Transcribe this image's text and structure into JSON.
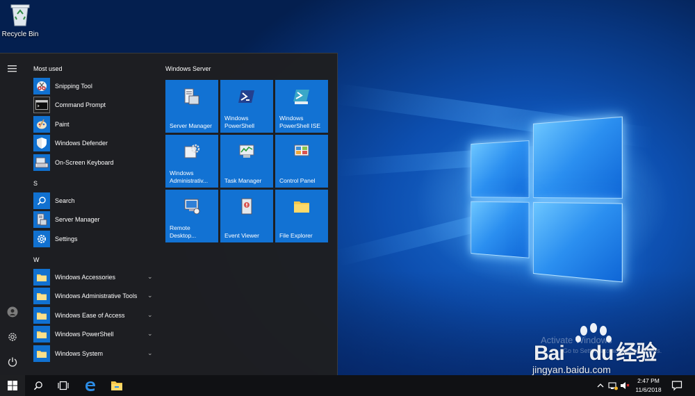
{
  "desktop": {
    "recycle_bin_label": "Recycle Bin",
    "watermark": {
      "activate": "Activate Windows",
      "activate_sub": "Go to Settings to activate Windows.",
      "brand_cn": "经验",
      "brand_text": "Bai",
      "brand_du": "du",
      "url": "jingyan.baidu.com"
    }
  },
  "start_menu": {
    "rail": {
      "hamburger_icon": "hamburger-icon",
      "user_icon": "user-icon",
      "settings_icon": "gear-icon",
      "power_icon": "power-icon"
    },
    "sections": [
      {
        "header": "Most used"
      },
      {
        "header": "S"
      },
      {
        "header": "W"
      }
    ],
    "apps": [
      {
        "label": "Snipping Tool",
        "icon": "scissors-icon"
      },
      {
        "label": "Command Prompt",
        "icon": "terminal-icon"
      },
      {
        "label": "Paint",
        "icon": "palette-icon"
      },
      {
        "label": "Windows Defender",
        "icon": "shield-icon"
      },
      {
        "label": "On-Screen Keyboard",
        "icon": "keyboard-icon"
      },
      {
        "label": "Search",
        "icon": "search-icon"
      },
      {
        "label": "Server Manager",
        "icon": "server-icon"
      },
      {
        "label": "Settings",
        "icon": "gear-icon"
      },
      {
        "label": "Windows Accessories",
        "icon": "folder-icon"
      },
      {
        "label": "Windows Administrative Tools",
        "icon": "folder-icon"
      },
      {
        "label": "Windows Ease of Access",
        "icon": "folder-icon"
      },
      {
        "label": "Windows PowerShell",
        "icon": "folder-icon"
      },
      {
        "label": "Windows System",
        "icon": "folder-icon"
      }
    ],
    "tiles_group": "Windows Server",
    "tiles": [
      {
        "label": "Server Manager",
        "icon": "server-icon"
      },
      {
        "label": "Windows PowerShell",
        "icon": "powershell-icon"
      },
      {
        "label": "Windows PowerShell ISE",
        "icon": "powershell-ise-icon"
      },
      {
        "label": "Windows Administrativ...",
        "icon": "admin-tools-icon"
      },
      {
        "label": "Task Manager",
        "icon": "task-manager-icon"
      },
      {
        "label": "Control Panel",
        "icon": "control-panel-icon"
      },
      {
        "label": "Remote Desktop...",
        "icon": "remote-desktop-icon"
      },
      {
        "label": "Event Viewer",
        "icon": "event-viewer-icon"
      },
      {
        "label": "File Explorer",
        "icon": "folder-icon"
      }
    ]
  },
  "taskbar": {
    "buttons": [
      "windows-logo-icon",
      "search-icon",
      "task-view-icon",
      "edge-icon",
      "file-explorer-icon"
    ],
    "clock_time": "2:47 PM",
    "clock_date": "11/6/2018",
    "tray": [
      "chevron-up-icon",
      "network-icon",
      "volume-icon",
      "notification-icon"
    ]
  },
  "colors": {
    "accent": "#1272d3",
    "menu_bg": "#1e1f22",
    "taskbar_bg": "#101114"
  }
}
